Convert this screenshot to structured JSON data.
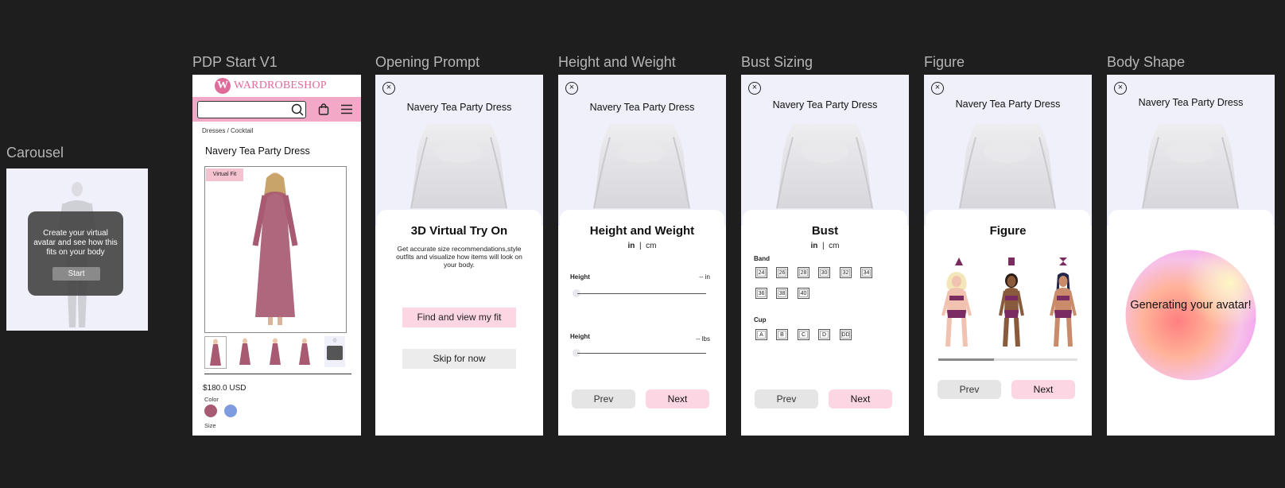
{
  "frames": {
    "carousel": {
      "label": "Carousel",
      "overlay_text": "Create your virtual avatar and see how this fits on your body",
      "start_label": "Start"
    },
    "pdp": {
      "label": "PDP Start V1",
      "logo_letter": "W",
      "logo_text": "WARDROBESHOP",
      "breadcrumb": "Dresses / Cocktail",
      "title": "Navery Tea Party Dress",
      "badge": "Virtual Fit",
      "price": "$180.0 USD",
      "color_label": "Color",
      "size_label": "Size",
      "swatches": [
        "#a85a72",
        "#7e9be0"
      ]
    },
    "opening": {
      "label": "Opening Prompt",
      "product": "Navery Tea Party Dress",
      "heading": "3D Virtual Try On",
      "description": "Get accurate size recommendations,style outfits and visualize how items will look on your body.",
      "primary_button": "Find and view my fit",
      "secondary_button": "Skip for now"
    },
    "height_weight": {
      "label": "Height and Weight",
      "product": "Navery Tea Party Dress",
      "heading": "Height and Weight",
      "unit_in": "in",
      "unit_sep": "|",
      "unit_cm": "cm",
      "slider1_label": "Height",
      "slider1_value": "-- in",
      "slider2_label": "Height",
      "slider2_value": "-- lbs",
      "prev": "Prev",
      "next": "Next"
    },
    "bust": {
      "label": "Bust Sizing",
      "product": "Navery Tea Party Dress",
      "heading": "Bust",
      "unit_in": "in",
      "unit_sep": "|",
      "unit_cm": "cm",
      "band_label": "Band",
      "bands": [
        "24",
        "26",
        "28",
        "30",
        "32",
        "34",
        "36",
        "38",
        "40"
      ],
      "cup_label": "Cup",
      "cups": [
        "A",
        "B",
        "C",
        "D",
        "DD"
      ],
      "prev": "Prev",
      "next": "Next"
    },
    "figure": {
      "label": "Figure",
      "product": "Navery Tea Party Dress",
      "heading": "Figure",
      "progress": 0.4,
      "prev": "Prev",
      "next": "Next"
    },
    "body_shape": {
      "label": "Body Shape",
      "product": "Navery Tea Party Dress",
      "generating": "Generating your avatar!"
    }
  },
  "colors": {
    "canvas": "#1e1e1e",
    "brand_pink": "#f3a8c7",
    "button_pink": "#fcd6e2",
    "button_gray": "#e5e5e5",
    "avatar_bg": "#f0f0fa",
    "figure_accent": "#7a2b5f"
  }
}
